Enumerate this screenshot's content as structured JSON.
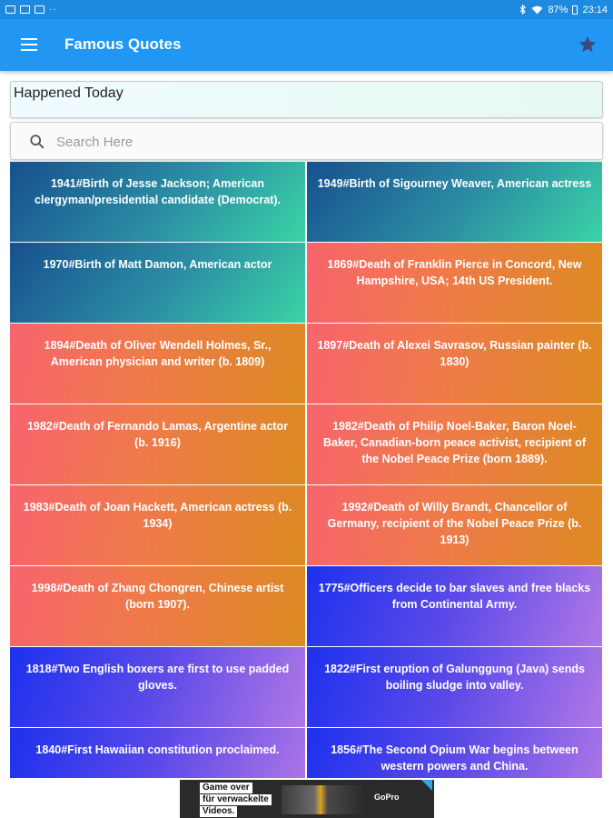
{
  "status_bar": {
    "icons": [
      "gallery-icon",
      "image-icon",
      "video-icon",
      "more-icon",
      "bluetooth-icon",
      "wifi-icon"
    ],
    "more_dots": "··",
    "battery": "87%",
    "time": "23:14"
  },
  "app_bar": {
    "title": "Famous Quotes",
    "menu_icon": "menu-icon",
    "favorite_icon": "star-icon",
    "color": "#2196f3"
  },
  "category_label": "Happened Today",
  "search": {
    "placeholder": "Search Here",
    "value": ""
  },
  "cards": [
    {
      "text": "1941#Birth of Jesse Jackson; American clergyman/presidential candidate (Democrat).",
      "style": "teal"
    },
    {
      "text": "1949#Birth of Sigourney Weaver, American actress",
      "style": "teal"
    },
    {
      "text": "1970#Birth of Matt Damon, American actor",
      "style": "teal"
    },
    {
      "text": "1869#Death of Franklin Pierce in Concord, New Hampshire, USA; 14th US President.",
      "style": "orange"
    },
    {
      "text": "1894#Death of Oliver Wendell Holmes, Sr., American physician and writer (b. 1809)",
      "style": "orange"
    },
    {
      "text": "1897#Death of Alexei Savrasov, Russian painter (b. 1830)",
      "style": "orange"
    },
    {
      "text": "1982#Death of Fernando Lamas, Argentine actor (b. 1916)",
      "style": "orange"
    },
    {
      "text": "1982#Death of Philip Noel-Baker, Baron Noel-Baker, Canadian-born peace activist, recipient of the Nobel Peace Prize (born 1889).",
      "style": "orange"
    },
    {
      "text": "1983#Death of Joan Hackett, American actress (b. 1934)",
      "style": "orange"
    },
    {
      "text": "1992#Death of Willy Brandt, Chancellor of Germany, recipient of the Nobel Peace Prize (b. 1913)",
      "style": "orange"
    },
    {
      "text": "1998#Death of Zhang Chongren, Chinese artist (born 1907).",
      "style": "orange"
    },
    {
      "text": "1775#Officers decide to bar slaves and free blacks from Continental Army.",
      "style": "purple"
    },
    {
      "text": "1818#Two English boxers are first to use padded gloves.",
      "style": "purple"
    },
    {
      "text": "1822#First eruption of Galunggung (Java) sends boiling sludge into valley.",
      "style": "purple"
    },
    {
      "text": "1840#First Hawaiian constitution proclaimed.",
      "style": "purple"
    },
    {
      "text": "1856#The Second Opium War begins between western powers and China.",
      "style": "purple"
    }
  ],
  "ad": {
    "line1": "Game over",
    "line2": "für verwackelte",
    "line3": "Videos.",
    "brand": "GoPro"
  }
}
